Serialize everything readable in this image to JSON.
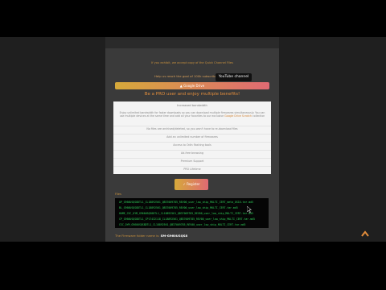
{
  "page": {
    "notice": "If you exhibit, we accept copy of the Quick Channel Files",
    "help_text": "Help us reach the goal of 100k subscribers to our",
    "youtube_badge": "YouTube channel",
    "gdrive_button": "Google Drive",
    "pro_heading": "Be a PRO user and enjoy multiple benefits!",
    "panel": {
      "title": "Increased bandwidth",
      "desc_before": "Enjoy unlimited bandwidth for faster downloads so you can download multiple firmwares simultaneously. You can use multiple devices at the same time and add all your favorites to our exclusive",
      "desc_highlight": "Google Drive Scratch",
      "desc_after": "collection",
      "rows": [
        "No files are archived/deleted, so you won't have to re-download files",
        "Add an unlimited number of firmwares",
        "Access to Odin flashing tools",
        "Ad-free browsing",
        "Premium Support",
        "PRO Lifetime"
      ]
    },
    "register_button": "Register",
    "files_label": "Files",
    "files": [
      "AP_G960USQS8DTL1_CL18892561_QB37009785_REV00_user_low_ship_MULTI_CERT_meta_OS10.tar.md5",
      "BL_G960USQS8DTL1_CL18892561_QB37009785_REV00_user_low_ship_MULTI_CERT.tar.md5",
      "HOME_CSC_OYM_G960USQS8DTL1_CL18892561_QB37009785_REV00_user_low_ship_MULTI_CERT.tar.md5",
      "CP_G960USQS8DTL1_CP17432118_CL18892561_QB37009785_REV00_user_low_ship_MULTI_CERT.tar.md5",
      "CSC_OYM_G960USQS8DTL1_CL18892561_QB37009785_REV00_user_low_ship_MULTI_CERT.tar.md5"
    ],
    "firmware_label": "The Firmware folder name is:",
    "firmware_value": "SM-G960USQS8"
  }
}
